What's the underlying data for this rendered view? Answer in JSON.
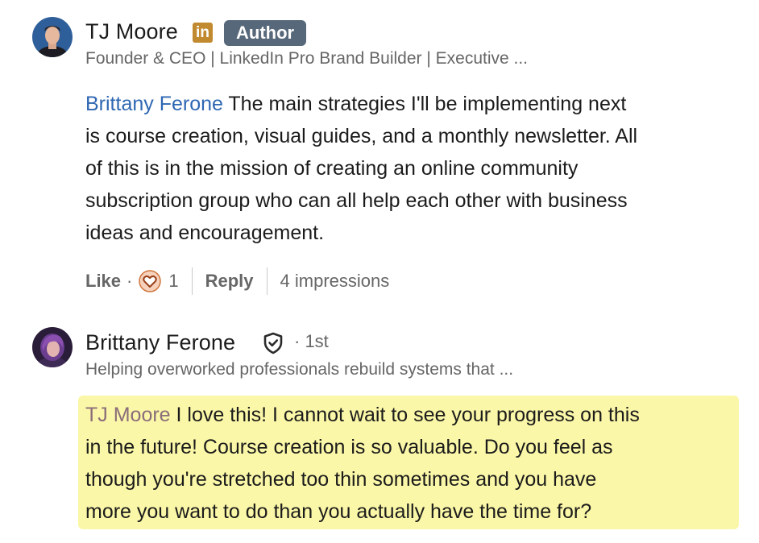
{
  "comment1": {
    "author_name": "TJ Moore",
    "linkedin_icon_text": "in",
    "author_badge": "Author",
    "headline": "Founder & CEO | LinkedIn Pro Brand Builder | Executive ...",
    "mention": "Brittany Ferone",
    "text_lines": [
      " The main strategies I'll be implementing next",
      "is course creation, visual guides, and a monthly newsletter. All",
      "of this is in the mission of creating an online community",
      "subscription group who can all help each other with business",
      "ideas and encouragement."
    ],
    "actions": {
      "like": "Like",
      "dot": "·",
      "reaction_count": "1",
      "reply": "Reply",
      "impressions": "4 impressions"
    }
  },
  "comment2": {
    "author_name": "Brittany Ferone",
    "degree": "· 1st",
    "headline": "Helping overworked professionals rebuild systems that ...",
    "mention": "TJ Moore",
    "text_lines": [
      " I love this! I cannot wait to see your progress on this",
      "in the future! Course creation is so valuable. Do you feel as",
      "though you're stretched too thin sometimes and you have",
      "more you want to do than you actually have the time for?"
    ]
  },
  "colors": {
    "mention_blue": "#2e67b2",
    "highlight_yellow": "#fbf7a8",
    "author_badge": "#56687a",
    "linkedin_gold": "#c28a30",
    "heart_reaction": "#d0743c"
  },
  "icons": {
    "verified": "shield-check-icon",
    "reaction": "heart-reaction-icon"
  }
}
